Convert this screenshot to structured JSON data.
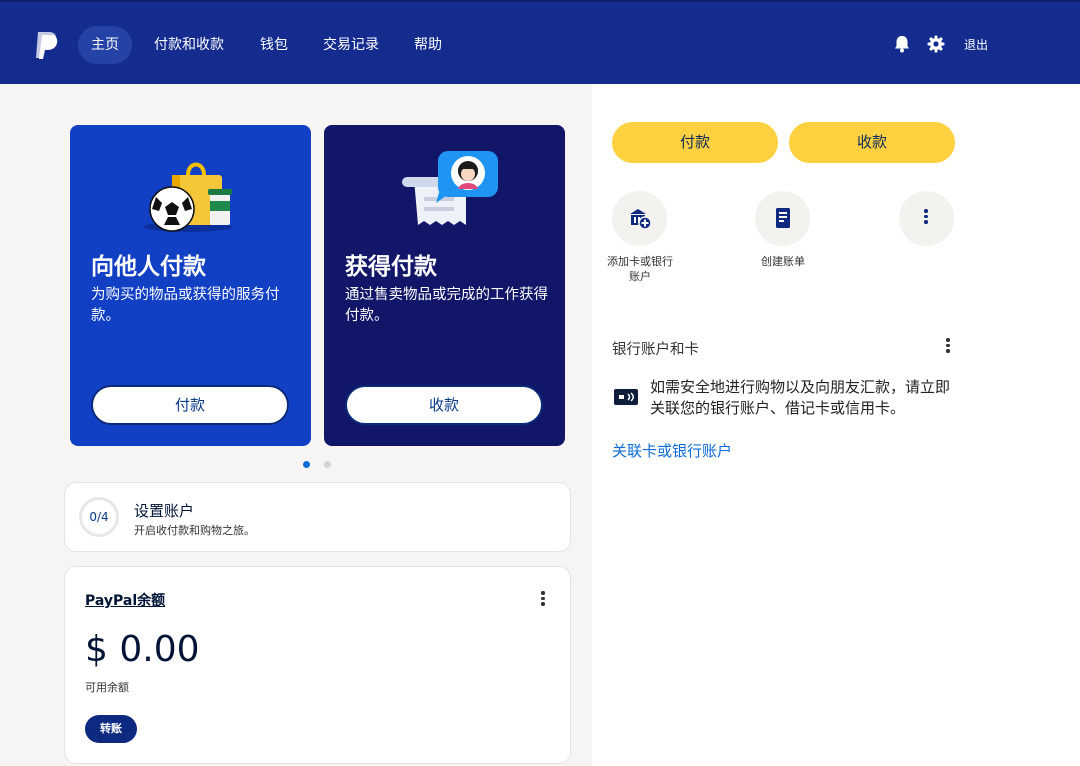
{
  "header": {
    "nav": [
      "主页",
      "付款和收款",
      "钱包",
      "交易记录",
      "帮助"
    ],
    "logout": "退出"
  },
  "promos": [
    {
      "title": "向他人付款",
      "desc": "为购买的物品或获得的服务付款。",
      "button": "付款"
    },
    {
      "title": "获得付款",
      "desc": "通过售卖物品或完成的工作获得付款。",
      "button": "收款"
    }
  ],
  "setup": {
    "progress": "0/4",
    "title": "设置账户",
    "subtitle": "开启收付款和购物之旅。"
  },
  "balance": {
    "title": "PayPal余额",
    "amount": "$ 0.00",
    "label": "可用余额",
    "transfer": "转账"
  },
  "actions": {
    "pay": "付款",
    "receive": "收款",
    "add_card": "添加卡或银行账户",
    "create_invoice": "创建账单"
  },
  "bank_section": {
    "title": "银行账户和卡",
    "text": "如需安全地进行购物以及向朋友汇款，请立即关联您的银行账户、借记卡或信用卡。",
    "link": "关联卡或银行账户"
  },
  "colors": {
    "header": "#142c8e",
    "promo_blue": "#1240c4",
    "promo_navy": "#111668",
    "yellow": "#ffd140",
    "link": "#0d6bd8"
  }
}
